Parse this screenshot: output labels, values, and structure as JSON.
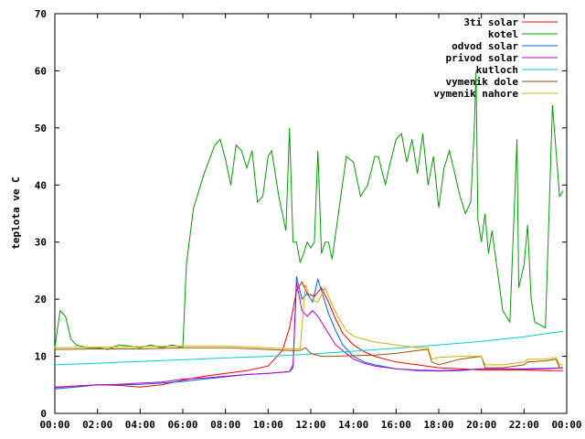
{
  "chart_data": {
    "type": "line",
    "title": "",
    "xlabel": "",
    "ylabel": "teplota ve C",
    "xlim": [
      "00:00",
      "24:00"
    ],
    "ylim": [
      0,
      70
    ],
    "x_ticks": [
      "00:00",
      "02:00",
      "04:00",
      "06:00",
      "08:00",
      "10:00",
      "12:00",
      "14:00",
      "16:00",
      "18:00",
      "20:00",
      "22:00",
      "00:00"
    ],
    "y_ticks": [
      "0",
      "10",
      "20",
      "30",
      "40",
      "50",
      "60",
      "70"
    ],
    "grid": false,
    "legend_position": "top-right",
    "series": [
      {
        "name": "3ti solar",
        "color": "#ff0000",
        "x": [
          "00:00",
          "01:00",
          "02:00",
          "03:00",
          "04:00",
          "05:00",
          "06:00",
          "07:00",
          "08:00",
          "09:00",
          "10:00",
          "10:40",
          "11:00",
          "11:20",
          "11:35",
          "11:50",
          "12:10",
          "12:30",
          "12:50",
          "13:10",
          "13:30",
          "14:00",
          "14:30",
          "15:00",
          "16:00",
          "17:00",
          "18:00",
          "19:00",
          "20:00",
          "21:00",
          "22:00",
          "23:00",
          "23:50"
        ],
        "values": [
          4.5,
          4.8,
          5.0,
          4.9,
          4.6,
          5.0,
          5.8,
          6.5,
          7.0,
          7.5,
          8.3,
          11.0,
          15.0,
          21.5,
          23.0,
          21.0,
          20.5,
          22.0,
          19.5,
          16.5,
          14.0,
          12.0,
          10.8,
          10.0,
          9.0,
          8.5,
          8.0,
          7.8,
          7.6,
          7.6,
          7.6,
          7.5,
          7.5
        ]
      },
      {
        "name": "kotel",
        "color": "#00a000",
        "x": [
          "00:00",
          "00:15",
          "00:30",
          "00:45",
          "01:00",
          "01:30",
          "02:00",
          "02:30",
          "03:00",
          "03:30",
          "04:00",
          "04:30",
          "05:00",
          "05:30",
          "06:00",
          "06:10",
          "06:30",
          "07:00",
          "07:30",
          "07:45",
          "08:00",
          "08:15",
          "08:30",
          "08:45",
          "09:00",
          "09:15",
          "09:30",
          "09:45",
          "10:00",
          "10:10",
          "10:30",
          "10:40",
          "10:50",
          "11:00",
          "11:10",
          "11:20",
          "11:30",
          "11:40",
          "11:50",
          "12:00",
          "12:10",
          "12:20",
          "12:30",
          "12:40",
          "12:50",
          "13:00",
          "13:20",
          "13:40",
          "14:00",
          "14:20",
          "14:40",
          "15:00",
          "15:10",
          "15:30",
          "15:40",
          "16:00",
          "16:15",
          "16:30",
          "16:45",
          "17:00",
          "17:15",
          "17:30",
          "17:45",
          "18:00",
          "18:15",
          "18:30",
          "18:45",
          "19:00",
          "19:15",
          "19:30",
          "19:40",
          "19:45",
          "19:50",
          "20:00",
          "20:10",
          "20:20",
          "20:30",
          "21:00",
          "21:20",
          "21:40",
          "21:45",
          "22:00",
          "22:10",
          "22:20",
          "22:30",
          "23:00",
          "23:20",
          "23:30",
          "23:40",
          "23:50"
        ],
        "values": [
          11.5,
          18,
          17,
          13,
          12,
          11.5,
          11.5,
          11.2,
          12,
          11.8,
          11.5,
          12,
          11.5,
          12,
          11.5,
          26,
          36,
          42,
          47,
          48,
          44.5,
          40,
          47,
          46,
          43,
          46,
          37,
          38,
          45,
          46,
          38,
          35,
          32,
          50,
          30,
          30,
          26.5,
          28,
          30,
          29,
          30,
          46,
          28,
          30,
          30,
          27,
          36,
          45,
          44,
          38,
          40,
          45,
          45,
          40,
          43,
          48,
          49,
          44,
          48,
          42,
          49,
          40,
          45,
          36,
          43,
          46,
          42,
          38,
          35,
          37,
          50,
          60,
          34,
          30,
          35,
          28,
          32,
          18,
          16,
          48,
          22,
          26,
          33,
          20,
          16,
          15,
          54,
          46,
          38,
          39
        ]
      },
      {
        "name": "odvod solar",
        "color": "#0060ff",
        "x": [
          "00:00",
          "01:00",
          "02:00",
          "03:00",
          "04:00",
          "05:00",
          "06:00",
          "07:00",
          "08:00",
          "09:00",
          "10:00",
          "11:00",
          "11:10",
          "11:20",
          "11:35",
          "11:50",
          "12:05",
          "12:20",
          "12:35",
          "12:50",
          "13:10",
          "13:30",
          "14:00",
          "14:30",
          "15:00",
          "16:00",
          "17:00",
          "18:00",
          "19:00",
          "20:00",
          "21:00",
          "22:00",
          "23:00",
          "23:50"
        ],
        "values": [
          4.3,
          4.6,
          5.0,
          5.0,
          5.1,
          5.3,
          5.6,
          6.0,
          6.4,
          6.8,
          7.0,
          7.3,
          8.0,
          24.0,
          20.0,
          21.0,
          19.5,
          23.5,
          20.5,
          17.5,
          14.5,
          12.0,
          10.0,
          9.0,
          8.5,
          7.8,
          7.6,
          7.5,
          7.6,
          7.8,
          7.8,
          7.8,
          7.9,
          8.0
        ]
      },
      {
        "name": "privod solar",
        "color": "#c000c0",
        "x": [
          "00:00",
          "01:00",
          "02:00",
          "03:00",
          "04:00",
          "05:00",
          "06:00",
          "07:00",
          "08:00",
          "09:00",
          "10:00",
          "11:00",
          "11:10",
          "11:20",
          "11:35",
          "11:50",
          "12:05",
          "12:20",
          "12:35",
          "12:50",
          "13:10",
          "13:30",
          "14:00",
          "14:30",
          "15:00",
          "16:00",
          "17:00",
          "18:00",
          "19:00",
          "20:00",
          "21:00",
          "22:00",
          "23:00",
          "23:50"
        ],
        "values": [
          4.6,
          4.8,
          5.0,
          5.1,
          5.3,
          5.5,
          6.0,
          6.2,
          6.5,
          6.8,
          7.0,
          7.3,
          8.5,
          23.0,
          18.0,
          17.0,
          18.0,
          17.0,
          15.5,
          14.0,
          12.0,
          11.0,
          9.5,
          8.8,
          8.3,
          7.8,
          7.5,
          7.4,
          7.5,
          7.8,
          7.8,
          7.7,
          7.8,
          8.0
        ]
      },
      {
        "name": "kutloch",
        "color": "#00d0d0",
        "x": [
          "00:00",
          "02:00",
          "04:00",
          "06:00",
          "08:00",
          "10:00",
          "12:00",
          "14:00",
          "16:00",
          "18:00",
          "20:00",
          "22:00",
          "23:50"
        ],
        "values": [
          8.5,
          8.8,
          9.1,
          9.4,
          9.7,
          10.0,
          10.4,
          10.9,
          11.4,
          12.0,
          12.6,
          13.4,
          14.4
        ]
      },
      {
        "name": "vymenik dole",
        "color": "#a05000",
        "x": [
          "00:00",
          "02:00",
          "04:00",
          "06:00",
          "08:00",
          "10:00",
          "11:00",
          "11:30",
          "11:45",
          "12:00",
          "12:30",
          "13:00",
          "14:00",
          "15:00",
          "16:00",
          "17:00",
          "17:30",
          "17:40",
          "18:00",
          "19:00",
          "20:00",
          "20:10",
          "21:00",
          "22:00",
          "22:10",
          "23:00",
          "23:30",
          "23:40",
          "23:50"
        ],
        "values": [
          11.2,
          11.3,
          11.3,
          11.5,
          11.5,
          11.2,
          11.0,
          11.0,
          11.5,
          10.5,
          10.0,
          10.0,
          10.1,
          10.2,
          10.5,
          11.0,
          11.2,
          9.0,
          8.5,
          9.5,
          10.0,
          8.0,
          8.0,
          8.5,
          9.0,
          9.2,
          9.5,
          8.0,
          8.0
        ]
      },
      {
        "name": "vymenik nahore",
        "color": "#d0b000",
        "x": [
          "00:00",
          "02:00",
          "04:00",
          "06:00",
          "08:00",
          "10:00",
          "11:00",
          "11:30",
          "11:45",
          "12:00",
          "12:20",
          "12:40",
          "13:00",
          "13:20",
          "13:40",
          "14:00",
          "15:00",
          "16:00",
          "17:00",
          "17:30",
          "17:40",
          "18:00",
          "19:00",
          "20:00",
          "20:10",
          "21:00",
          "22:00",
          "22:10",
          "23:00",
          "23:30",
          "23:40",
          "23:50"
        ],
        "values": [
          11.5,
          11.6,
          11.7,
          11.8,
          11.8,
          11.5,
          11.3,
          11.3,
          22.5,
          20.0,
          19.5,
          22.0,
          19.0,
          16.5,
          14.5,
          13.5,
          12.5,
          12.0,
          11.5,
          11.5,
          9.5,
          9.8,
          10.0,
          10.0,
          8.5,
          8.5,
          9.0,
          9.5,
          9.5,
          9.8,
          8.5,
          8.5
        ]
      }
    ]
  }
}
